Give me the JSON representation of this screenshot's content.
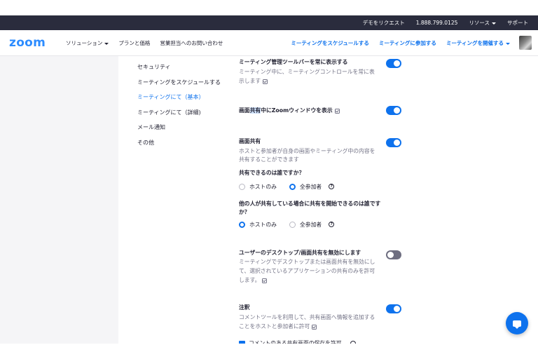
{
  "topbar": {
    "demo": "デモをリクエスト",
    "phone": "1.888.799.0125",
    "resources": "リソース",
    "support": "サポート"
  },
  "nav": {
    "logo": "zoom",
    "solutions": "ソリューション",
    "pricing": "プランと価格",
    "contact_sales": "営業担当へのお問い合わせ",
    "schedule": "ミーティングをスケジュールする",
    "join": "ミーティングに参加する",
    "host": "ミーティングを開催する"
  },
  "sidebar": {
    "items": [
      {
        "label": "セキュリティ"
      },
      {
        "label": "ミーティングをスケジュールする"
      },
      {
        "label": "ミーティングにて（基本）"
      },
      {
        "label": "ミーティングにて（詳細)"
      },
      {
        "label": "メール通知"
      },
      {
        "label": "その他"
      }
    ]
  },
  "settings": {
    "toolbar_title": "ミーティング管理ツールバーを常に表示する",
    "toolbar_desc_1": "ミーティング中に、ミーティングコントロールを常に表",
    "toolbar_desc_2": "示します",
    "zoom_window_pre": "画面",
    "zoom_window_hl": "共有",
    "zoom_window_post": "中にZoomウィンドウを表示",
    "screen_share_title": "画面共有",
    "screen_share_desc_1": "ホストと参加者が自身の画面やミーティング中の内容を",
    "screen_share_desc_2": "共有することができます",
    "who_can_share": "共有できるのは誰ですか？",
    "option_host_only": "ホストのみ",
    "option_all": "全参加者",
    "who_can_start_1": "他の人が共有している場合に共有を開始できるのは誰です",
    "who_can_start_2": "か？",
    "disable_title": "ユーザーのデスクトップ/画面共有を無効にします",
    "disable_desc_1": "ミーティングでデスクトップまたは画面共有を無効にし",
    "disable_desc_2": "て、選択されているアプリケーションの共有のみを許可",
    "disable_desc_3": "します。",
    "annotation_title": "注釈",
    "annotation_desc_1": "コメントツールを利用して、共有画面へ情報を追加する",
    "annotation_desc_2": "ことをホストと参加者に許可",
    "cut_text": "コメントのある共有画面の保存を許可"
  },
  "toggles": {
    "toolbar": "on",
    "zoom_window": "on",
    "screen_share": "on",
    "disable_share": "off",
    "annotation": "on"
  },
  "colors": {
    "accent": "#0e72ed",
    "topbar": "#2a2c3d",
    "logo": "#2d8cff"
  },
  "icons": {
    "chat": "chat-bubble-icon",
    "info": "info-icon",
    "help": "help-circle-icon"
  }
}
